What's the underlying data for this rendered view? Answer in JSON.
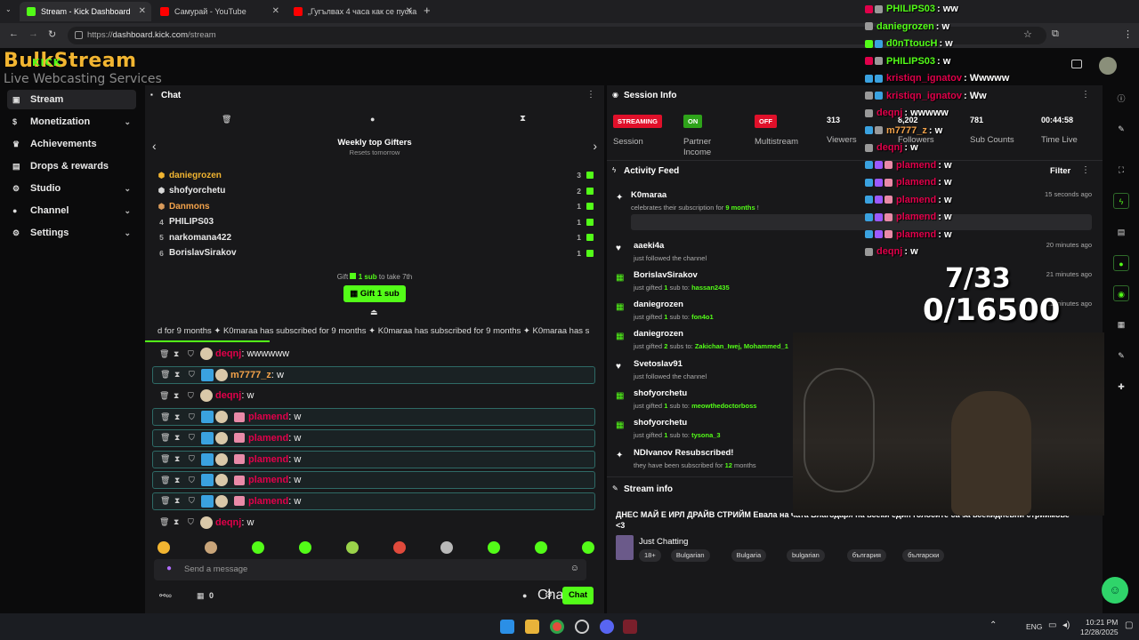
{
  "browser": {
    "tabs": [
      {
        "title": "Stream - Kick Dashboard",
        "active": true,
        "color": "#53fc18"
      },
      {
        "title": "Самурай - YouTube",
        "active": false,
        "color": "#ff0000"
      },
      {
        "title": "„Гугълваx 4 часа как се пуска",
        "active": false,
        "color": "#ff0000"
      }
    ],
    "url_prefix": "https://",
    "url_host": "dashboard.kick.com",
    "url_path": "/stream",
    "new_tab": "+"
  },
  "logo": {
    "line1": "BulkStream",
    "line2": "Live Webcasting Services",
    "kick": "KICK"
  },
  "sidebar": {
    "items": [
      {
        "label": "Stream",
        "icon": "broadcast-icon",
        "active": true
      },
      {
        "label": "Monetization",
        "icon": "dollar-icon",
        "chevron": true
      },
      {
        "label": "Achievements",
        "icon": "trophy-icon"
      },
      {
        "label": "Drops & rewards",
        "icon": "gift-icon"
      },
      {
        "label": "Studio",
        "icon": "gear-icon",
        "chevron": true
      },
      {
        "label": "Channel",
        "icon": "user-icon",
        "chevron": true
      },
      {
        "label": "Settings",
        "icon": "gear-icon",
        "chevron": true
      }
    ]
  },
  "chat": {
    "title": "Chat",
    "gifters_title": "Weekly top Gifters",
    "gifters_subtitle": "Resets tomorrow",
    "gifters": [
      {
        "rank": "",
        "name": "daniegrozen",
        "count": "3",
        "color": "#f2b531"
      },
      {
        "rank": "",
        "name": "shofyorchetu",
        "count": "2",
        "color": "#e8e8e8"
      },
      {
        "rank": "",
        "name": "Danmons",
        "count": "1",
        "color": "#f2a24a"
      },
      {
        "rank": "4",
        "name": "PHILIPS03",
        "count": "1",
        "color": "#e8e8e8"
      },
      {
        "rank": "5",
        "name": "narkomana422",
        "count": "1",
        "color": "#e8e8e8"
      },
      {
        "rank": "6",
        "name": "BorislavSirakov",
        "count": "1",
        "color": "#e8e8e8"
      }
    ],
    "gift_hint_pre": "Gift",
    "gift_hint_sub": "1 sub",
    "gift_hint_post": "to take 7th",
    "gift_button": "Gift 1 sub",
    "ticker": "d for 9 months  ✦  K0maraa has subscribed for 9 months  ✦  K0maraa has subscribed for 9 months  ✦  K0maraa has s",
    "messages": [
      {
        "user": "deqnj",
        "text": ": wwwwww",
        "color": "#e0004a",
        "hl": false,
        "sub": false,
        "gift": false
      },
      {
        "user": "m7777_z",
        "text": ": w",
        "color": "#f2a24a",
        "hl": true,
        "sub": true,
        "gift": false
      },
      {
        "user": "deqnj",
        "text": ": w",
        "color": "#e0004a",
        "hl": false,
        "sub": false,
        "gift": false
      },
      {
        "user": "plamend",
        "text": ": w",
        "color": "#e0004a",
        "hl": true,
        "sub": true,
        "gift": true
      },
      {
        "user": "plamend",
        "text": ": w",
        "color": "#e0004a",
        "hl": true,
        "sub": true,
        "gift": true
      },
      {
        "user": "plamend",
        "text": ": w",
        "color": "#e0004a",
        "hl": true,
        "sub": true,
        "gift": true
      },
      {
        "user": "plamend",
        "text": ": w",
        "color": "#e0004a",
        "hl": true,
        "sub": true,
        "gift": true
      },
      {
        "user": "plamend",
        "text": ": w",
        "color": "#e0004a",
        "hl": true,
        "sub": true,
        "gift": true
      },
      {
        "user": "deqnj",
        "text": ": w",
        "color": "#e0004a",
        "hl": false,
        "sub": false,
        "gift": false
      }
    ],
    "input_placeholder": "Send a message",
    "footer_count": "0",
    "chat_button": "Chat"
  },
  "session": {
    "title": "Session Info",
    "stats": [
      {
        "badge": "STREAMING",
        "badge_color": "#e0102a",
        "label": "Session"
      },
      {
        "badge": "ON",
        "badge_color": "#2ea31a",
        "label": "Partner Income"
      },
      {
        "badge": "OFF",
        "badge_color": "#e0102a",
        "label": "Multistream"
      },
      {
        "value": "313",
        "label": "Viewers"
      },
      {
        "value": "8,202",
        "label": "Followers"
      },
      {
        "value": "781",
        "label": "Sub Counts"
      },
      {
        "value": "00:44:58",
        "label": "Time Live"
      }
    ]
  },
  "activity": {
    "title": "Activity Feed",
    "filter": "Filter",
    "items": [
      {
        "name": "K0maraa",
        "sub_pre": "celebrates their subscription for",
        "sub_num": "9 months",
        "sub_post": "!",
        "time": "15 seconds ago",
        "icon": "sparkle-icon"
      },
      {
        "name": "aaeki4a",
        "sub_pre": "just followed the channel",
        "time": "20 minutes ago",
        "icon": "heart-icon"
      },
      {
        "name": "BorislavSirakov",
        "sub_pre": "just gifted",
        "sub_num": "1",
        "sub_mid": "sub to:",
        "sub_target": "hassan2435",
        "time": "21 minutes ago",
        "icon": "gift-icon"
      },
      {
        "name": "daniegrozen",
        "sub_pre": "just gifted",
        "sub_num": "1",
        "sub_mid": "sub to:",
        "sub_target": "fon4o1",
        "time": "21 minutes ago",
        "icon": "gift-icon"
      },
      {
        "name": "daniegrozen",
        "sub_pre": "just gifted",
        "sub_num": "2",
        "sub_mid": "subs to:",
        "sub_target": "Zakichan_Iwej, Mohammed_1",
        "time": "",
        "icon": "gift-icon"
      },
      {
        "name": "Svetoslav91",
        "sub_pre": "just followed the channel",
        "time": "",
        "icon": "heart-icon"
      },
      {
        "name": "shofyorchetu",
        "sub_pre": "just gifted",
        "sub_num": "1",
        "sub_mid": "sub to:",
        "sub_target": "meowthedoctorboss",
        "time": "",
        "icon": "gift-icon"
      },
      {
        "name": "shofyorchetu",
        "sub_pre": "just gifted",
        "sub_num": "1",
        "sub_mid": "sub to:",
        "sub_target": "tysona_3",
        "time": "",
        "icon": "gift-icon"
      },
      {
        "name": "NDIvanov Resubscribed!",
        "sub_pre": "they have been subscribed for",
        "sub_num": "12",
        "sub_post": "months",
        "time": "",
        "icon": "sparkle-icon"
      }
    ]
  },
  "stream_info": {
    "title": "Stream info",
    "stream_title": "ДНЕС МАЙ Е ИРЛ ДРАЙВ СТРИЙМ  Евала на чата   Благодаря на всеки един голосите са за всекидневни стриймове <3",
    "category": "Just Chatting",
    "tags": [
      "18+",
      "Bulgarian",
      "Bulgaria",
      "bulgarian",
      "българия",
      "български"
    ]
  },
  "overlay": {
    "chat": [
      {
        "user": "PHILIPS03",
        "text": ": ww",
        "color": "#53fc18"
      },
      {
        "user": "daniegrozen",
        "text": ": w",
        "color": "#53fc18"
      },
      {
        "user": "d0nTtoucH",
        "text": ": w",
        "color": "#53fc18"
      },
      {
        "user": "PHILIPS03",
        "text": ": w",
        "color": "#53fc18"
      },
      {
        "user": "kristiqn_ignatov",
        "text": ": Wwwww",
        "color": "#e0004a"
      },
      {
        "user": "kristiqn_ignatov",
        "text": ": Ww",
        "color": "#e0004a"
      },
      {
        "user": "deqnj",
        "text": ": wwwww",
        "color": "#e0004a"
      },
      {
        "user": "m7777_z",
        "text": ": w",
        "color": "#f2a24a"
      },
      {
        "user": "deqnj",
        "text": ": w",
        "color": "#e0004a"
      },
      {
        "user": "plamend",
        "text": ": w",
        "color": "#e0004a"
      },
      {
        "user": "plamend",
        "text": ": w",
        "color": "#e0004a"
      },
      {
        "user": "plamend",
        "text": ": w",
        "color": "#e0004a"
      },
      {
        "user": "plamend",
        "text": ": w",
        "color": "#e0004a"
      },
      {
        "user": "plamend",
        "text": ": w",
        "color": "#e0004a"
      },
      {
        "user": "deqnj",
        "text": ": w",
        "color": "#e0004a"
      }
    ],
    "goal_subs": "7/33",
    "goal_value": "0/16500"
  },
  "taskbar": {
    "lang": "ENG",
    "time": "10:21 PM",
    "date": "12/28/2025"
  },
  "colors": {
    "accent": "#53fc18",
    "panel": "#18181a",
    "bg": "#0b0b0c"
  }
}
